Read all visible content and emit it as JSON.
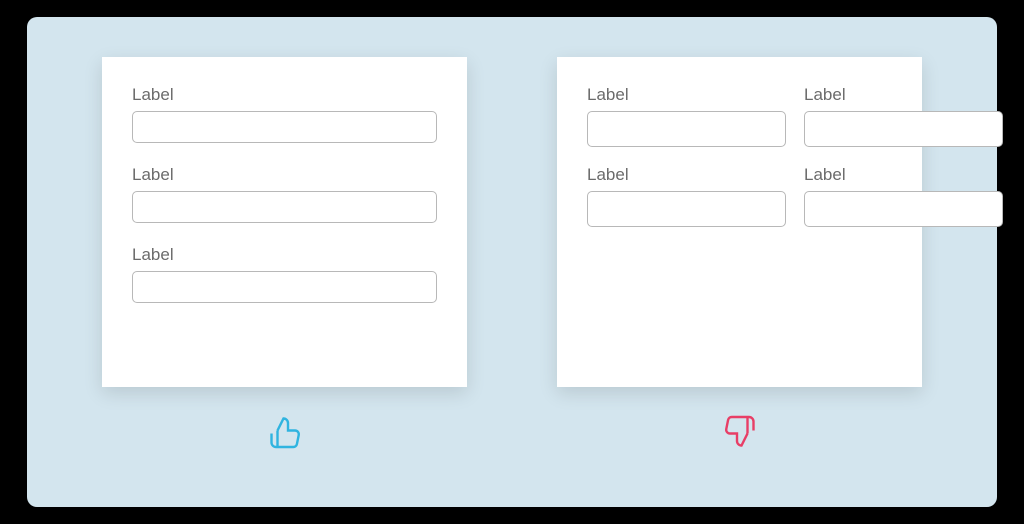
{
  "good_example": {
    "layout": "single-column",
    "fields": [
      {
        "label": "Label"
      },
      {
        "label": "Label"
      },
      {
        "label": "Label"
      }
    ],
    "rating_icon": "thumbs-up"
  },
  "bad_example": {
    "layout": "multi-column",
    "fields": [
      {
        "label": "Label"
      },
      {
        "label": "Label"
      },
      {
        "label": "Label"
      },
      {
        "label": "Label"
      }
    ],
    "rating_icon": "thumbs-down"
  },
  "colors": {
    "background": "#d3e5ee",
    "card": "#ffffff",
    "label_text": "#6b6b6b",
    "input_border": "#b8b8b8",
    "good": "#2fb4e0",
    "bad": "#e83e66"
  }
}
